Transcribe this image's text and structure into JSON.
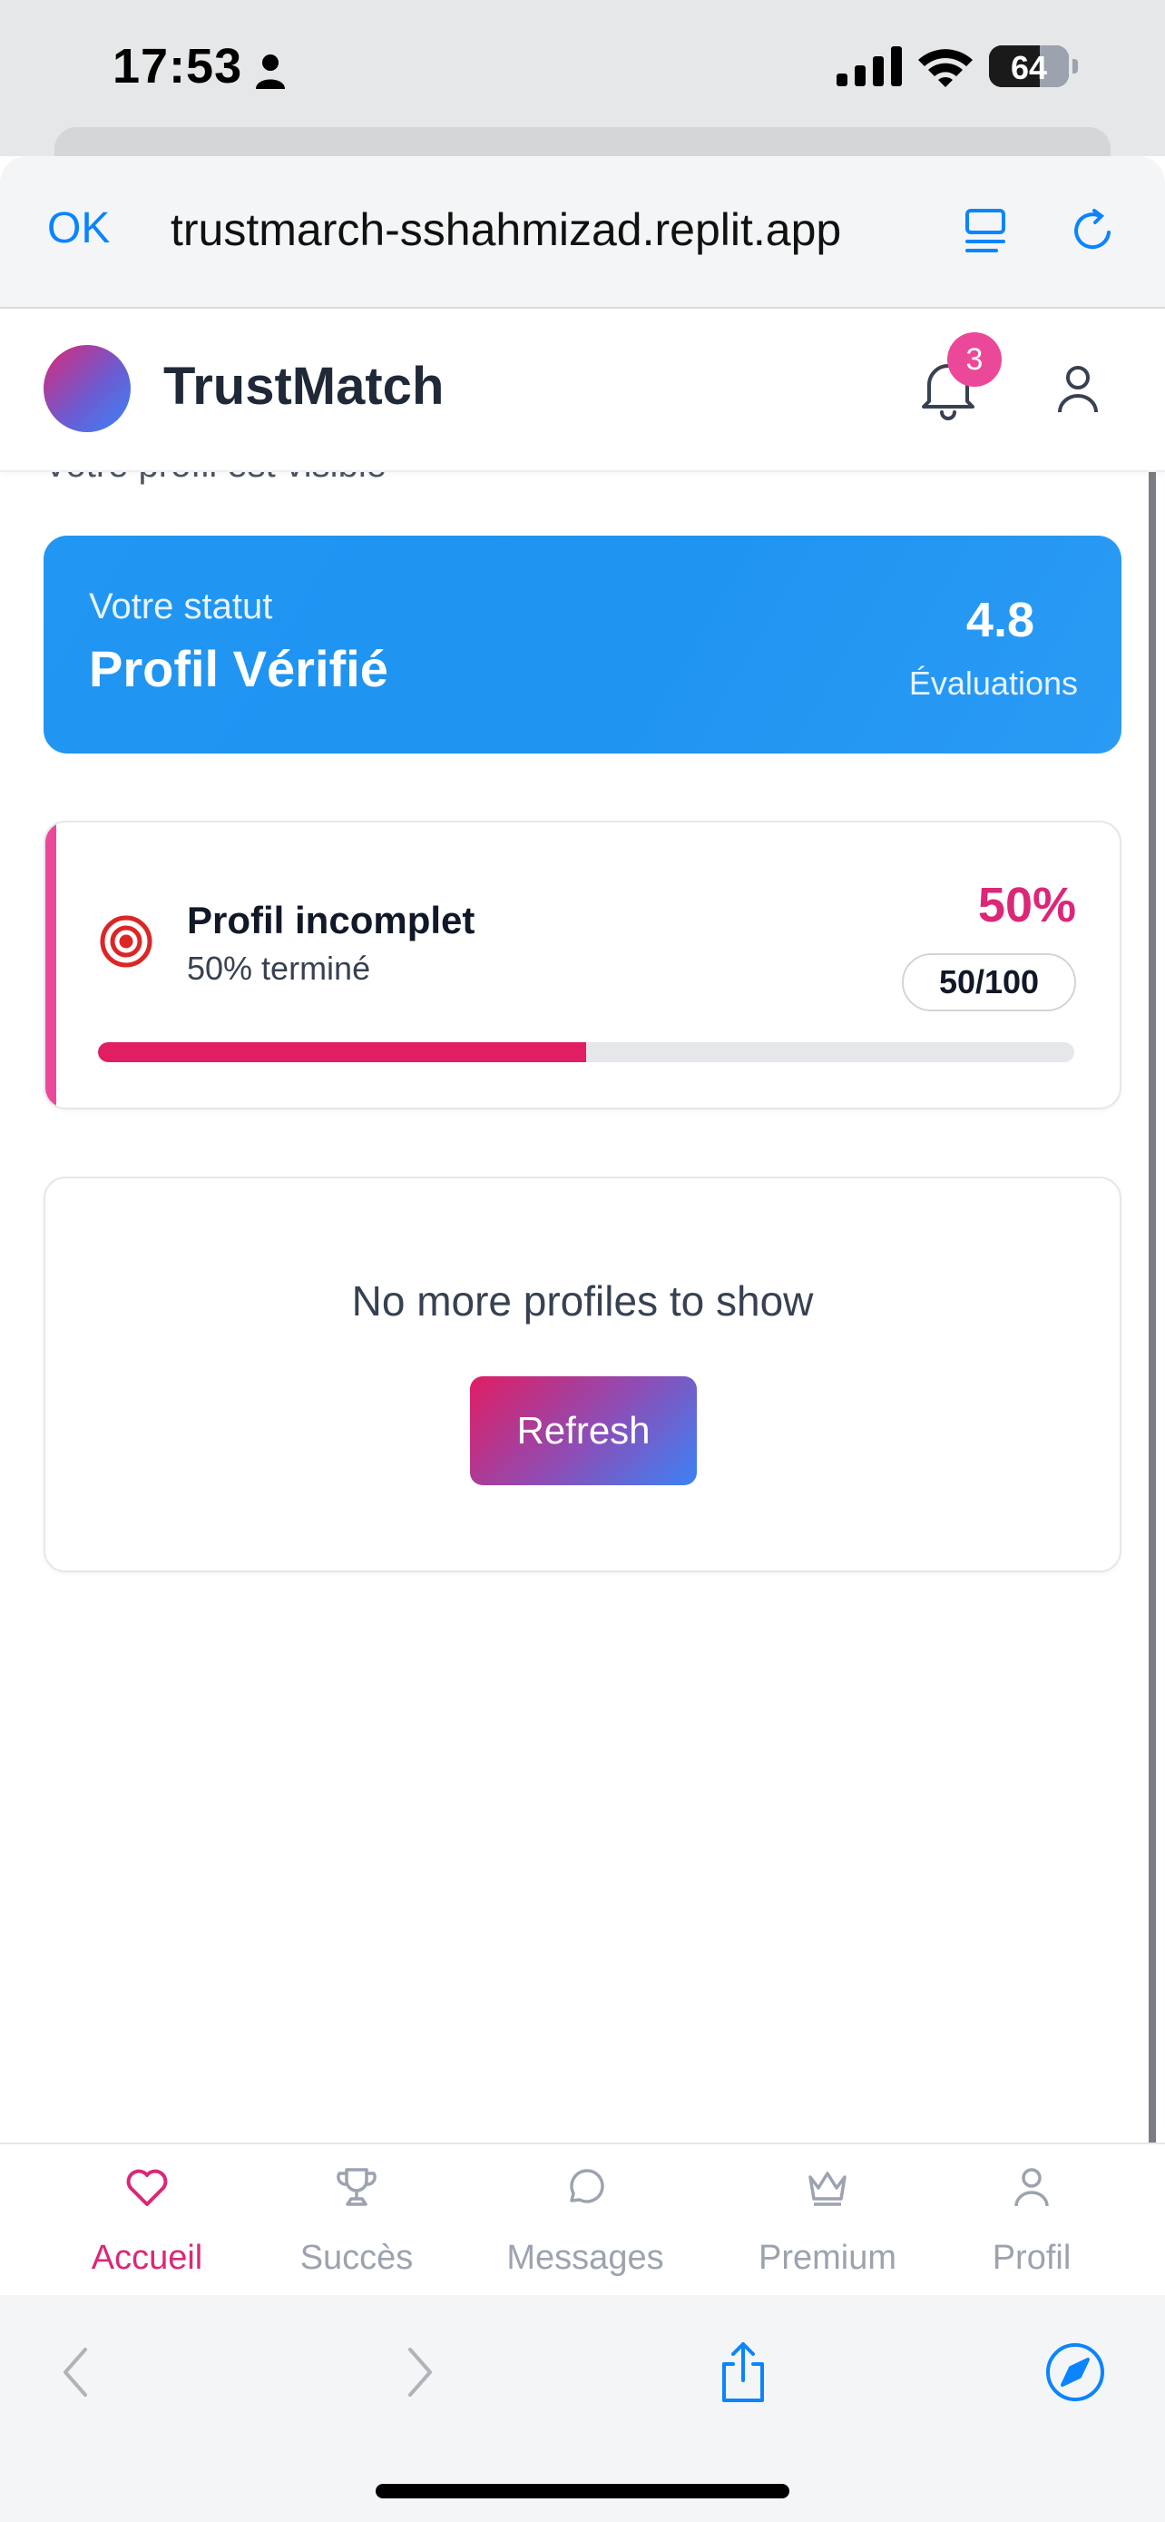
{
  "status_bar": {
    "time": "17:53",
    "battery": "64",
    "battery_level": 0.64
  },
  "browser": {
    "ok_label": "OK",
    "url": "trustmarch-sshahmizad.replit.app"
  },
  "app": {
    "title": "TrustMatch",
    "notification_count": "3"
  },
  "page": {
    "visibility_text": "Votre profil est visible",
    "status_card": {
      "label": "Votre statut",
      "value": "Profil Vérifié",
      "rating": "4.8",
      "rating_label": "Évaluations"
    },
    "progress_card": {
      "title": "Profil incomplet",
      "subtitle": "50% terminé",
      "percent": "50%",
      "score": "50/100",
      "progress": 0.5
    },
    "empty_state": {
      "message": "No more profiles to show",
      "refresh_label": "Refresh"
    }
  },
  "tabs": [
    {
      "label": "Accueil",
      "icon": "heart-icon",
      "active": true
    },
    {
      "label": "Succès",
      "icon": "trophy-icon",
      "active": false
    },
    {
      "label": "Messages",
      "icon": "message-bubble-icon",
      "active": false
    },
    {
      "label": "Premium",
      "icon": "crown-icon",
      "active": false
    },
    {
      "label": "Profil",
      "icon": "user-icon",
      "active": false
    }
  ],
  "colors": {
    "accent_pink": "#db2777",
    "status_blue": "#2196f3",
    "ios_blue": "#0a84ff",
    "badge_pink": "#ec4899"
  }
}
